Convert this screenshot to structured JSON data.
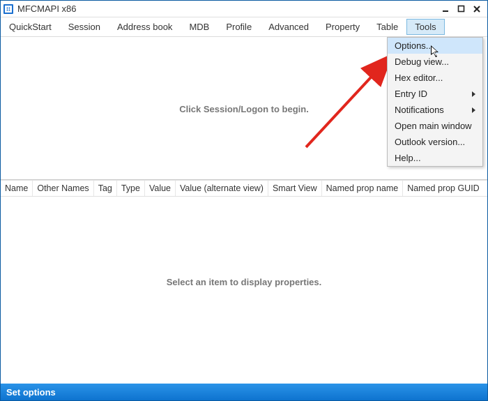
{
  "window": {
    "title": "MFCMAPI x86"
  },
  "menubar": {
    "items": [
      "QuickStart",
      "Session",
      "Address book",
      "MDB",
      "Profile",
      "Advanced",
      "Property",
      "Table",
      "Tools"
    ],
    "active_index": 8
  },
  "dropdown": {
    "items": [
      {
        "label": "Options...",
        "submenu": false,
        "hover": true
      },
      {
        "label": "Debug view...",
        "submenu": false,
        "hover": false
      },
      {
        "label": "Hex editor...",
        "submenu": false,
        "hover": false
      },
      {
        "label": "Entry ID",
        "submenu": true,
        "hover": false
      },
      {
        "label": "Notifications",
        "submenu": true,
        "hover": false
      },
      {
        "label": "Open main window",
        "submenu": false,
        "hover": false
      },
      {
        "label": "Outlook version...",
        "submenu": false,
        "hover": false
      },
      {
        "label": "Help...",
        "submenu": false,
        "hover": false
      }
    ]
  },
  "upper_pane": {
    "placeholder": "Click Session/Logon to begin."
  },
  "table": {
    "columns": [
      "Name",
      "Other Names",
      "Tag",
      "Type",
      "Value",
      "Value (alternate view)",
      "Smart View",
      "Named prop name",
      "Named prop GUID"
    ]
  },
  "lower_pane": {
    "placeholder": "Select an item to display properties."
  },
  "statusbar": {
    "text": "Set options"
  },
  "annotation": {
    "arrow_color": "#e1261d"
  }
}
